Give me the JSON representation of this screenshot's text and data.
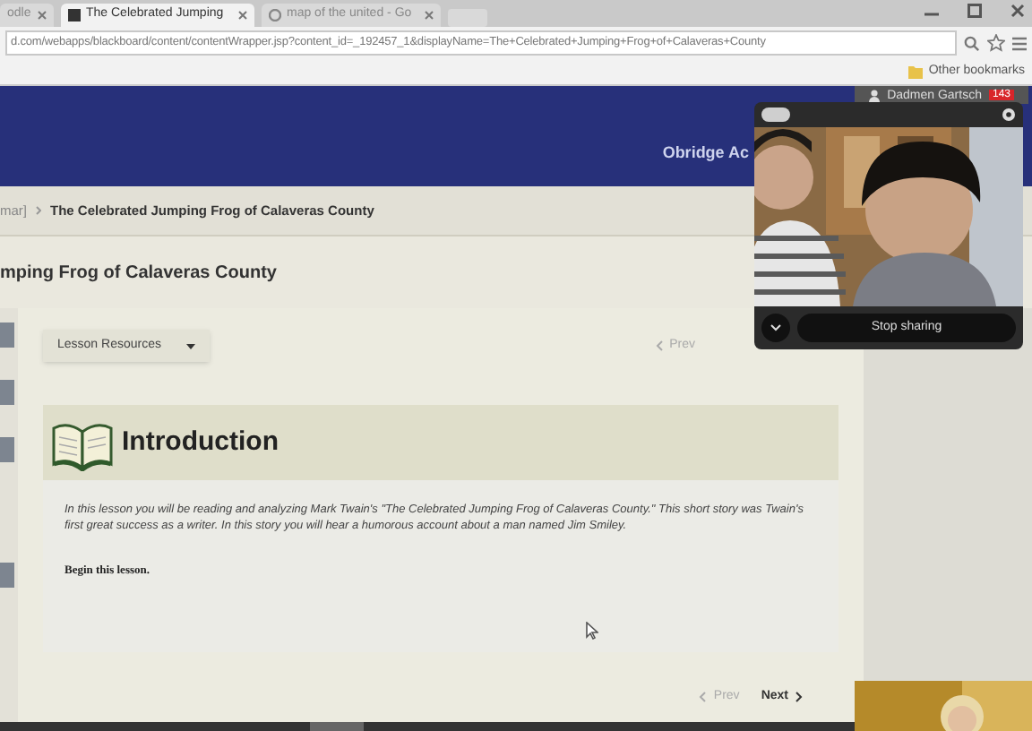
{
  "browser": {
    "tabs": [
      {
        "title": "odle",
        "selected": false
      },
      {
        "title": "The Celebrated Jumping",
        "selected": true
      },
      {
        "title": "map of the united - Go",
        "selected": false
      }
    ],
    "url": "d.com/webapps/blackboard/content/contentWrapper.jsp?content_id=_192457_1&displayName=The+Celebrated+Jumping+Frog+of+Calaveras+County",
    "bookmarks": [
      "Other bookmarks"
    ]
  },
  "header": {
    "user": "Dadmen Gartsch",
    "badge": "143",
    "nav_tab": "Obridge Ac"
  },
  "breadcrumbs": [
    "mar]",
    "The Celebrated Jumping Frog of Calaveras County"
  ],
  "page_title": "mping Frog of Calaveras County",
  "lesson_menu": "Lesson Resources",
  "top_pager": [
    {
      "label": "Prev",
      "disabled": true
    }
  ],
  "section": {
    "heading": "Introduction",
    "paragraph": "In this lesson you will be reading and analyzing Mark Twain's \"The Celebrated Jumping Frog of Calaveras County.\" This short story was Twain's first great success as a writer. In this story you will hear a humorous account about a man named Jim Smiley.",
    "instruction": "Begin this lesson."
  },
  "bottom_pager": [
    {
      "label": "Prev",
      "disabled": true
    },
    {
      "label": "Next",
      "disabled": false
    }
  ],
  "share_panel": {
    "button": "Stop sharing"
  }
}
